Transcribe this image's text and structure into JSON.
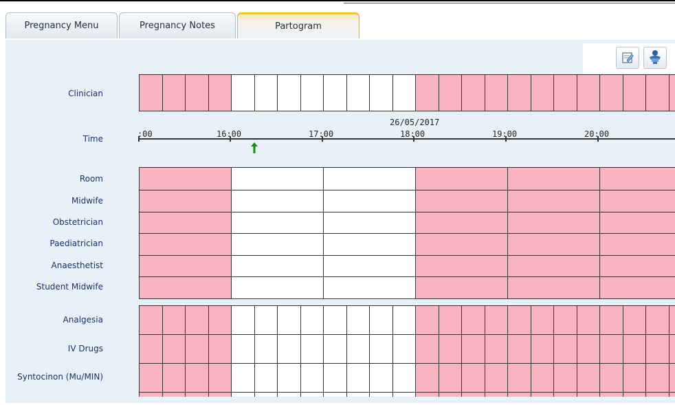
{
  "tabs": [
    {
      "label": "Pregnancy Menu"
    },
    {
      "label": "Pregnancy Notes"
    },
    {
      "label": "Partogram"
    }
  ],
  "toolbar": {
    "icons": [
      "edit-note-icon",
      "baby-icon"
    ]
  },
  "rows": {
    "clinician": "Clinician",
    "time": "Time",
    "room": "Room",
    "midwife": "Midwife",
    "obstetrician": "Obstetrician",
    "paediatrician": "Paediatrician",
    "anaesthetist": "Anaesthetist",
    "student_midwife": "Student Midwife",
    "analgesia": "Analgesia",
    "iv_drugs": "IV Drugs",
    "syntocinon": "Syntocinon (Mu/MIN)"
  },
  "timeline": {
    "date": "26/05/2017",
    "ticks": [
      ":00",
      "16:00",
      "17:00",
      "18:00",
      "19:00",
      "20:00"
    ],
    "current_marker": "up-arrow-icon"
  },
  "colors": {
    "pink": "#f8b4c0",
    "content_bg": "#e8f1f8",
    "label": "#1e2f66",
    "marker": "#1a8a1a"
  }
}
